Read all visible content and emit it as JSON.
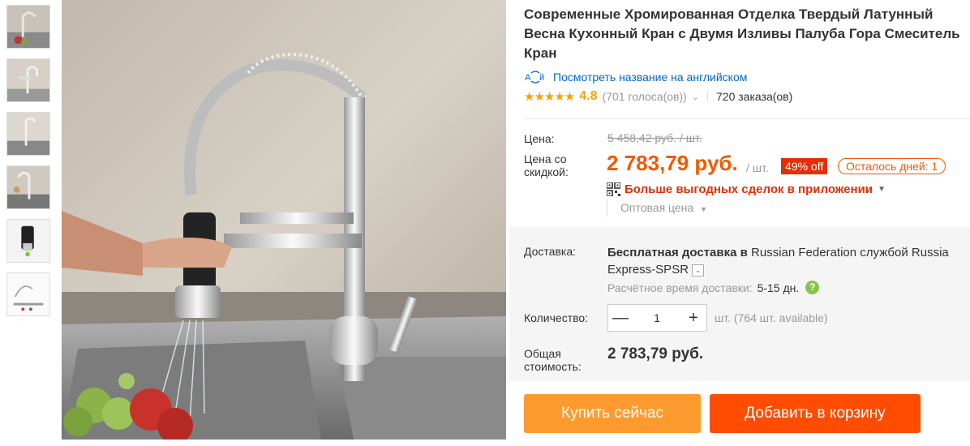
{
  "product": {
    "title": "Современные Хромированная Отделка Твердый Латунный Весна Кухонный Кран с Двумя Изливы Палуба Гора Смеситель Кран",
    "translate_link": "Посмотреть название на английском",
    "rating": {
      "stars": "★★★★★",
      "value": "4.8",
      "votes": "(701 голоса(ов))",
      "orders": "720 заказа(ов)"
    }
  },
  "gallery": {
    "thumbnails": [
      "faucet-thumb-1",
      "faucet-thumb-2",
      "faucet-thumb-3",
      "faucet-thumb-4",
      "faucet-thumb-5",
      "faucet-thumb-6"
    ]
  },
  "price": {
    "label": "Цена:",
    "old": "5 458,42 руб. / шт.",
    "discount_label_line1": "Цена со",
    "discount_label_line2": "скидкой:",
    "new": "2 783,79 руб.",
    "per_unit": "/ шт.",
    "discount_badge": "49% off",
    "days_left": "Осталось дней: 1",
    "app_deals": "Больше выгодных сделок в приложении",
    "wholesale": "Оптовая цена"
  },
  "shipping": {
    "label": "Доставка:",
    "free_text": "Бесплатная доставка в",
    "destination": "Russian Federation",
    "via_text": "службой",
    "service": "Russia Express-SPSR",
    "eta_label": "Расчётное время доставки:",
    "eta_value": "5-15 дн."
  },
  "quantity": {
    "label": "Количество:",
    "value": "1",
    "minus": "—",
    "plus": "+",
    "note": "шт. (764 шт. available)"
  },
  "total": {
    "label_line1": "Общая",
    "label_line2": "стоимость:",
    "value": "2 783,79 руб."
  },
  "actions": {
    "buy_now": "Купить сейчас",
    "add_to_cart": "Добавить в корзину"
  },
  "colors": {
    "accent_orange": "#f05a00",
    "discount_red": "#e62e04",
    "buy_button": "#ff9a2e",
    "cart_button": "#ff4c00",
    "link_blue": "#0066cc",
    "star": "#f7a200"
  }
}
